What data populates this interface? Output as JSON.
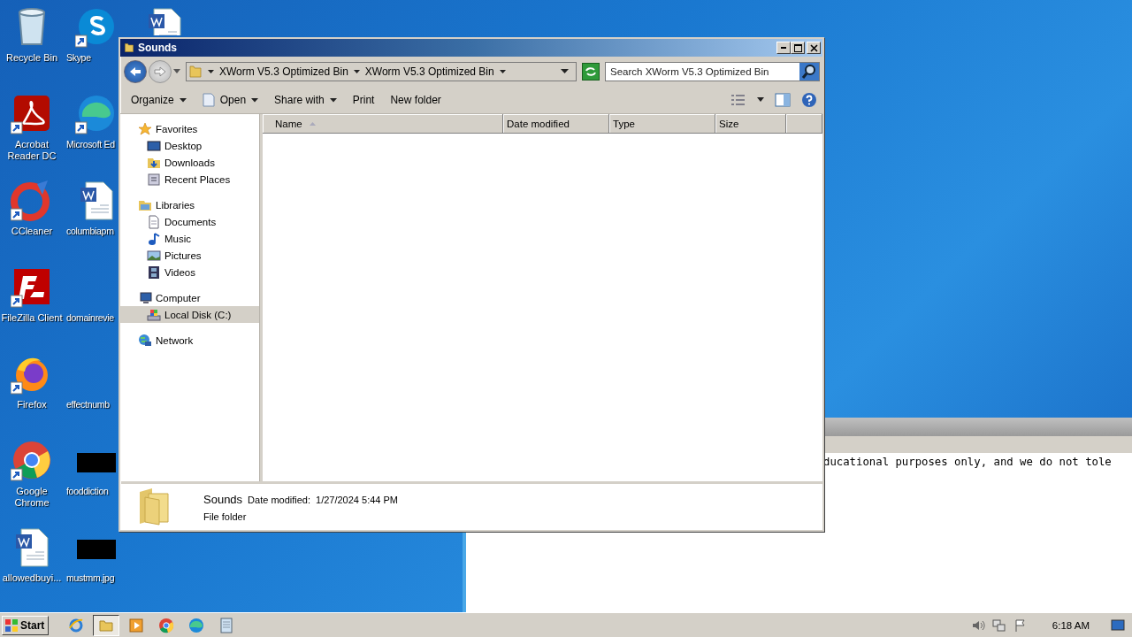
{
  "desktop": {
    "columns": [
      [
        {
          "label": "Recycle Bin",
          "kind": "bin",
          "shortcut": false
        },
        {
          "label": "Acrobat Reader DC",
          "kind": "pdf",
          "shortcut": true
        },
        {
          "label": "CCleaner",
          "kind": "ccleaner",
          "shortcut": true
        },
        {
          "label": "FileZilla Client",
          "kind": "filezilla",
          "shortcut": true
        },
        {
          "label": "Firefox",
          "kind": "firefox",
          "shortcut": true
        },
        {
          "label": "Google Chrome",
          "kind": "chrome",
          "shortcut": true
        },
        {
          "label": "allowedbuyi...",
          "kind": "word",
          "shortcut": false
        }
      ],
      [
        {
          "label": "Skype",
          "kind": "skype",
          "shortcut": true
        },
        {
          "label": "Microsoft Ed",
          "kind": "edge",
          "shortcut": true
        },
        {
          "label": "columbiapm",
          "kind": "word",
          "shortcut": false
        },
        {
          "label": "domainrevie",
          "kind": "blank",
          "shortcut": false
        },
        {
          "label": "effectnumb",
          "kind": "blank",
          "shortcut": false
        },
        {
          "label": "fooddiction",
          "kind": "dark",
          "shortcut": false
        },
        {
          "label": "mustmm.jpg",
          "kind": "dark",
          "shortcut": false
        }
      ],
      [
        {
          "kind": "word",
          "shortcut": false
        }
      ]
    ]
  },
  "background_window": {
    "text": "ducational purposes only, and we do not tole"
  },
  "window": {
    "title": "Sounds",
    "breadcrumb": [
      "XWorm V5.3 Optimized Bin",
      "XWorm V5.3 Optimized Bin"
    ],
    "search": {
      "placeholder": "Search XWorm V5.3 Optimized Bin"
    },
    "toolbar": [
      {
        "label": "Organize",
        "dropdown": true
      },
      {
        "label": "Open",
        "dropdown": true,
        "kind": "open"
      },
      {
        "label": "Share with",
        "dropdown": true
      },
      {
        "label": "Print",
        "dropdown": false
      },
      {
        "label": "New folder",
        "dropdown": false
      }
    ],
    "nav": [
      {
        "label": "Favorites",
        "kind": "star",
        "selected": false,
        "children": [
          {
            "label": "Desktop",
            "kind": "desktop",
            "selected": false
          },
          {
            "label": "Downloads",
            "kind": "downloads",
            "selected": false
          },
          {
            "label": "Recent Places",
            "kind": "recent",
            "selected": false
          }
        ]
      },
      {
        "label": "Libraries",
        "kind": "library",
        "selected": false,
        "children": [
          {
            "label": "Documents",
            "kind": "doc",
            "selected": false
          },
          {
            "label": "Music",
            "kind": "music",
            "selected": false
          },
          {
            "label": "Pictures",
            "kind": "pictures",
            "selected": false
          },
          {
            "label": "Videos",
            "kind": "videos",
            "selected": false
          }
        ]
      },
      {
        "label": "Computer",
        "kind": "computer",
        "selected": false,
        "children": [
          {
            "label": "Local Disk (C:)",
            "kind": "disk",
            "selected": true
          }
        ]
      },
      {
        "label": "Network",
        "kind": "network",
        "selected": false
      }
    ],
    "columns": [
      {
        "label": "Name",
        "sorted": true
      },
      {
        "label": "Date modified",
        "sorted": false
      },
      {
        "label": "Type",
        "sorted": false
      },
      {
        "label": "Size",
        "sorted": false
      }
    ],
    "details": {
      "name": "Sounds",
      "date_label": "Date modified:",
      "date": "1/27/2024 5:44 PM",
      "type": "File folder"
    }
  },
  "taskbar": {
    "start": "Start",
    "apps": [
      {
        "kind": "ie",
        "selected": false
      },
      {
        "kind": "folder",
        "selected": true
      },
      {
        "kind": "media",
        "selected": false
      },
      {
        "kind": "chrome",
        "selected": false
      },
      {
        "kind": "edge",
        "selected": false
      },
      {
        "kind": "notepad",
        "selected": false
      }
    ],
    "clock": "6:18 AM"
  }
}
